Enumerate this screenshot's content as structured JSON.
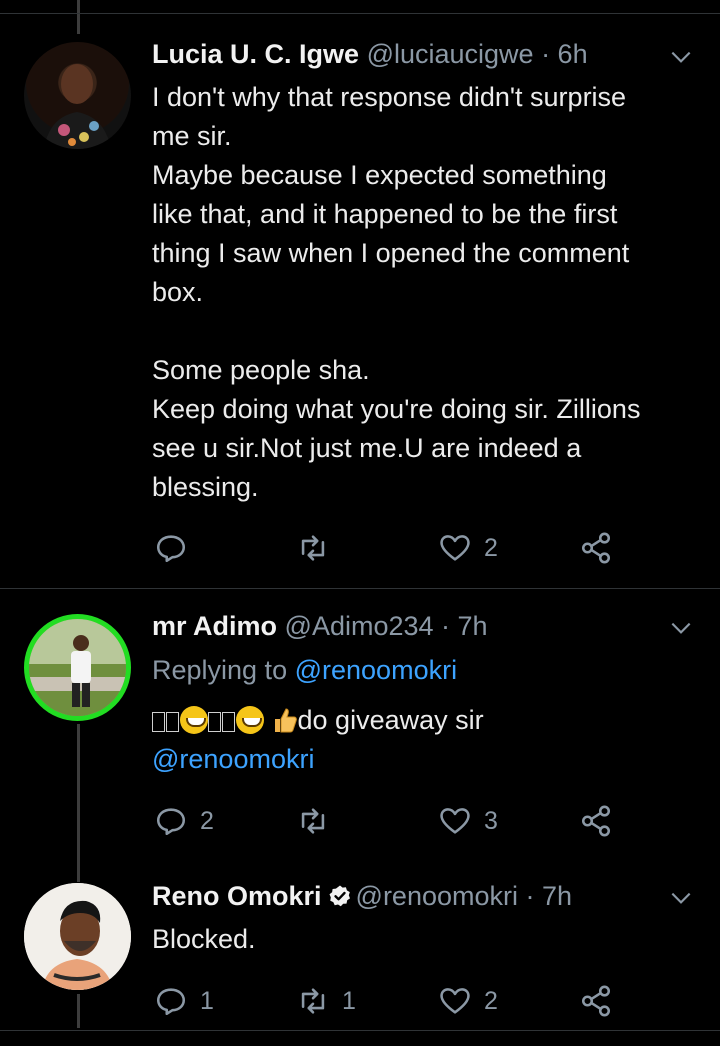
{
  "tweets": [
    {
      "name": "Lucia U. C. Igwe",
      "handle": "@luciaucigwe",
      "time": "· 6h",
      "text_lines": [
        "I don't why that response  didn't surprise",
        "me sir.",
        "Maybe because I expected something",
        "like that, and it happened to be the first",
        "thing I saw when I opened the comment",
        "box.",
        "",
        "Some people sha.",
        "Keep doing what you're doing sir. Zillions",
        "see u sir.Not just me.U are indeed a",
        "blessing."
      ],
      "reply_count": "",
      "retweet_count": "",
      "like_count": "2"
    },
    {
      "name": "mr Adimo",
      "handle": "@Adimo234",
      "time": "· 7h",
      "replying_label": "Replying to",
      "replying_to": "@renoomokri",
      "text_suffix": "do giveaway sir",
      "mention": "@renoomokri",
      "reply_count": "2",
      "retweet_count": "",
      "like_count": "3"
    },
    {
      "name": "Reno Omokri",
      "handle": "@renoomokri",
      "time": "· 7h",
      "text": "Blocked.",
      "reply_count": "1",
      "retweet_count": "1",
      "like_count": "2",
      "verified": true
    }
  ],
  "icons": {
    "reply": "reply-icon",
    "retweet": "retweet-icon",
    "like": "heart-icon",
    "share": "share-icon",
    "more": "chevron-down-icon",
    "verified": "verified-badge-icon"
  },
  "colors": {
    "background": "#000000",
    "link": "#3da3ff",
    "muted": "#8b98a5",
    "thread_line": "#3d3d3d"
  }
}
